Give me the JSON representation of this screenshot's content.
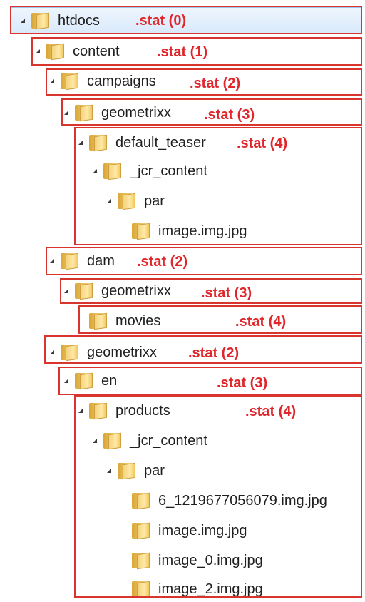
{
  "tree": [
    {
      "name": "htdocs",
      "stat": ".stat (0)"
    },
    {
      "name": "content",
      "stat": ".stat (1)"
    },
    {
      "name": "campaigns",
      "stat": ".stat (2)"
    },
    {
      "name": "geometrixx",
      "stat": ".stat (3)"
    },
    {
      "name": "default_teaser",
      "stat": ".stat (4)"
    },
    {
      "name": "_jcr_content",
      "stat": ""
    },
    {
      "name": "par",
      "stat": ""
    },
    {
      "name": "image.img.jpg",
      "stat": ""
    },
    {
      "name": "dam",
      "stat": ".stat (2)"
    },
    {
      "name": "geometrixx",
      "stat": ".stat (3)"
    },
    {
      "name": "movies",
      "stat": ".stat (4)"
    },
    {
      "name": "geometrixx",
      "stat": ".stat (2)"
    },
    {
      "name": "en",
      "stat": ".stat (3)"
    },
    {
      "name": "products",
      "stat": ".stat (4)"
    },
    {
      "name": "_jcr_content",
      "stat": ""
    },
    {
      "name": "par",
      "stat": ""
    },
    {
      "name": "6_1219677056079.img.jpg",
      "stat": ""
    },
    {
      "name": "image.img.jpg",
      "stat": ""
    },
    {
      "name": "image_0.img.jpg",
      "stat": ""
    },
    {
      "name": "image_2.img.jpg",
      "stat": ""
    }
  ],
  "colors": {
    "stat_label": "#e0262b",
    "selection_bg": "#d9e9fb",
    "annotation_border": "#d9352f"
  }
}
